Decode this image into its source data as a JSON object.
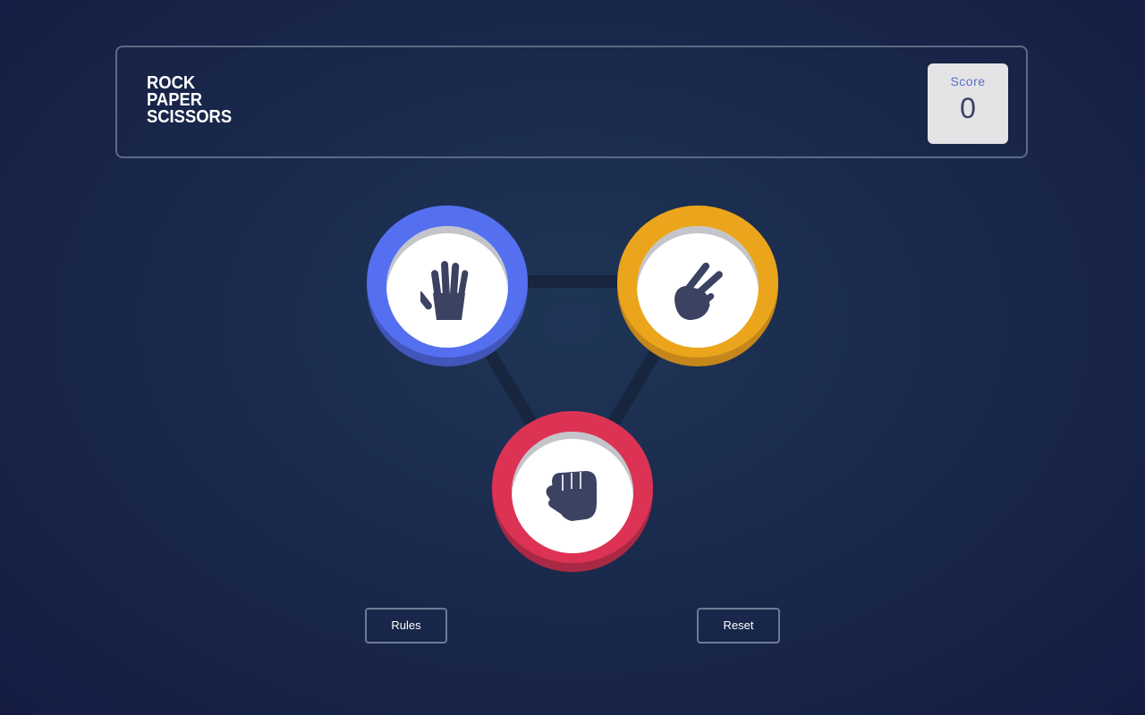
{
  "header": {
    "logo_lines": [
      "ROCK",
      "PAPER",
      "SCISSORS"
    ],
    "score_label": "Score",
    "score_value": "0"
  },
  "board": {
    "choices": [
      {
        "id": "paper",
        "color": "#5470f0",
        "icon": "paper-hand-icon"
      },
      {
        "id": "scissors",
        "color": "#eba51c",
        "icon": "scissors-hand-icon"
      },
      {
        "id": "rock",
        "color": "#dc3355",
        "icon": "rock-fist-icon"
      }
    ]
  },
  "buttons": {
    "rules_label": "Rules",
    "reset_label": "Reset"
  }
}
